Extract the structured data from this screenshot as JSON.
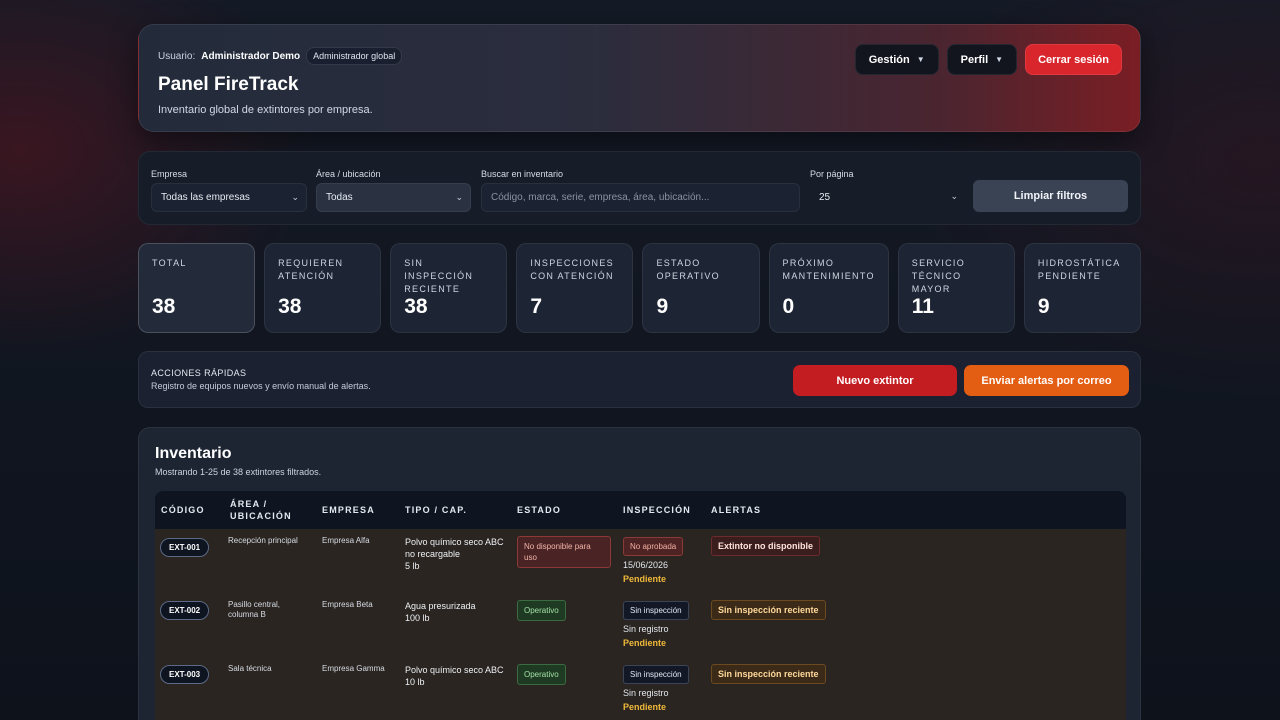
{
  "header": {
    "user_prefix": "Usuario:",
    "user_name": "Administrador Demo",
    "role": "Administrador global",
    "title": "Panel FireTrack",
    "subtitle": "Inventario global de extintores por empresa.",
    "gestion_label": "Gestión",
    "perfil_label": "Perfil",
    "logout_label": "Cerrar sesión"
  },
  "filters": {
    "empresa_label": "Empresa",
    "empresa_value": "Todas las empresas",
    "area_label": "Área / ubicación",
    "area_value": "Todas",
    "search_label": "Buscar en inventario",
    "search_placeholder": "Código, marca, serie, empresa, área, ubicación...",
    "per_page_label": "Por página",
    "per_page_value": "25",
    "clear_label": "Limpiar filtros"
  },
  "stats": [
    {
      "label": "Total",
      "value": "38"
    },
    {
      "label": "Requieren atención",
      "value": "38"
    },
    {
      "label": "Sin inspección reciente",
      "value": "38"
    },
    {
      "label": "Inspecciones con atención",
      "value": "7"
    },
    {
      "label": "Estado operativo",
      "value": "9"
    },
    {
      "label": "Próximo mantenimiento",
      "value": "0"
    },
    {
      "label": "Servicio técnico mayor",
      "value": "11"
    },
    {
      "label": "Hidrostática pendiente",
      "value": "9"
    }
  ],
  "quick": {
    "title": "ACCIONES RÁPIDAS",
    "subtitle": "Registro de equipos nuevos y envío manual de alertas.",
    "new_label": "Nuevo extintor",
    "alerts_label": "Enviar alertas por correo"
  },
  "inventory": {
    "title": "Inventario",
    "subtitle": "Mostrando 1-25 de 38 extintores filtrados.",
    "columns": [
      "CÓDIGO",
      "ÁREA / UBICACIÓN",
      "EMPRESA",
      "TIPO / CAP.",
      "ESTADO",
      "INSPECCIÓN",
      "ALERTAS"
    ],
    "rows": [
      {
        "code": "EXT-001",
        "area": "Recepción principal",
        "empresa": "Empresa Alfa",
        "tipo": "Polvo químico seco ABC no recargable",
        "cap": "5 lb",
        "estado": "No disponible para uso",
        "insp_badge": "No aprobada",
        "insp_text": "15/06/2026",
        "insp_status": "Pendiente",
        "alert": "Extintor no disponible"
      },
      {
        "code": "EXT-002",
        "area": "Pasillo central, columna B",
        "empresa": "Empresa Beta",
        "tipo": "Agua presurizada",
        "cap": "100 lb",
        "estado": "Operativo",
        "insp_badge": "Sin inspección",
        "insp_text": "Sin registro",
        "insp_status": "Pendiente",
        "alert": "Sin inspección reciente"
      },
      {
        "code": "EXT-003",
        "area": "Sala técnica",
        "empresa": "Empresa Gamma",
        "tipo": "Polvo químico seco ABC",
        "cap": "10 lb",
        "estado": "Operativo",
        "insp_badge": "Sin inspección",
        "insp_text": "Sin registro",
        "insp_status": "Pendiente",
        "alert": "Sin inspección reciente"
      }
    ]
  }
}
